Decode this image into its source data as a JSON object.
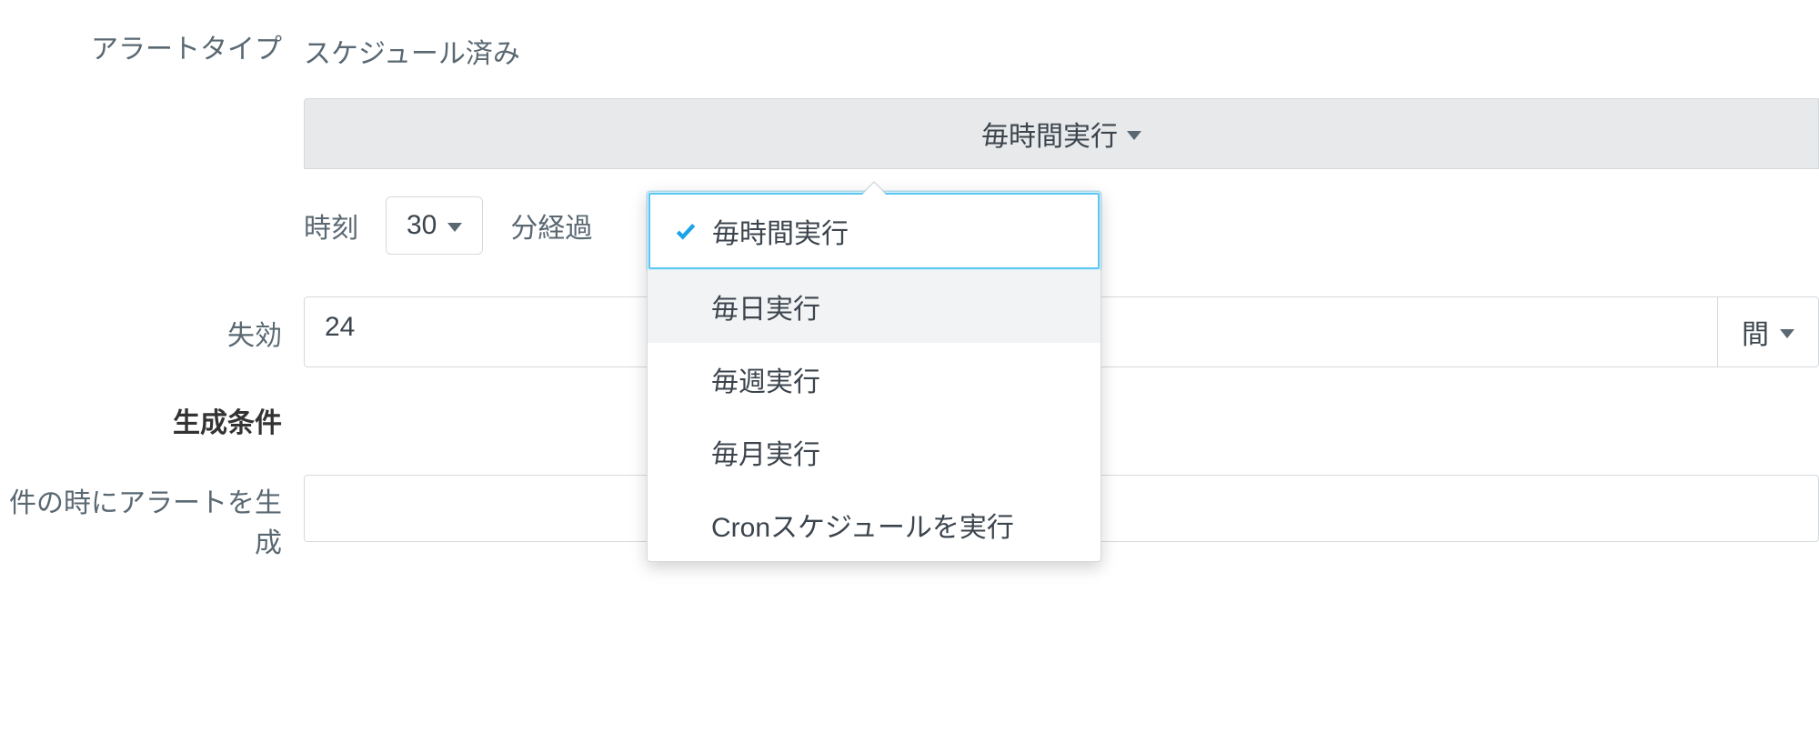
{
  "labels": {
    "alert_type": "アラートタイプ",
    "time": "時刻",
    "after_minute": "分経過",
    "expire": "失効",
    "condition": "生成条件",
    "trigger": "件の時にアラートを生成"
  },
  "values": {
    "alert_type": "スケジュール済み",
    "schedule_selected": "毎時間実行",
    "minute": "30",
    "expire_value": "24",
    "expire_unit_suffix": "間"
  },
  "dropdown": {
    "items": [
      "毎時間実行",
      "毎日実行",
      "毎週実行",
      "毎月実行",
      "Cronスケジュールを実行"
    ],
    "selected_index": 0,
    "hover_index": 1
  }
}
